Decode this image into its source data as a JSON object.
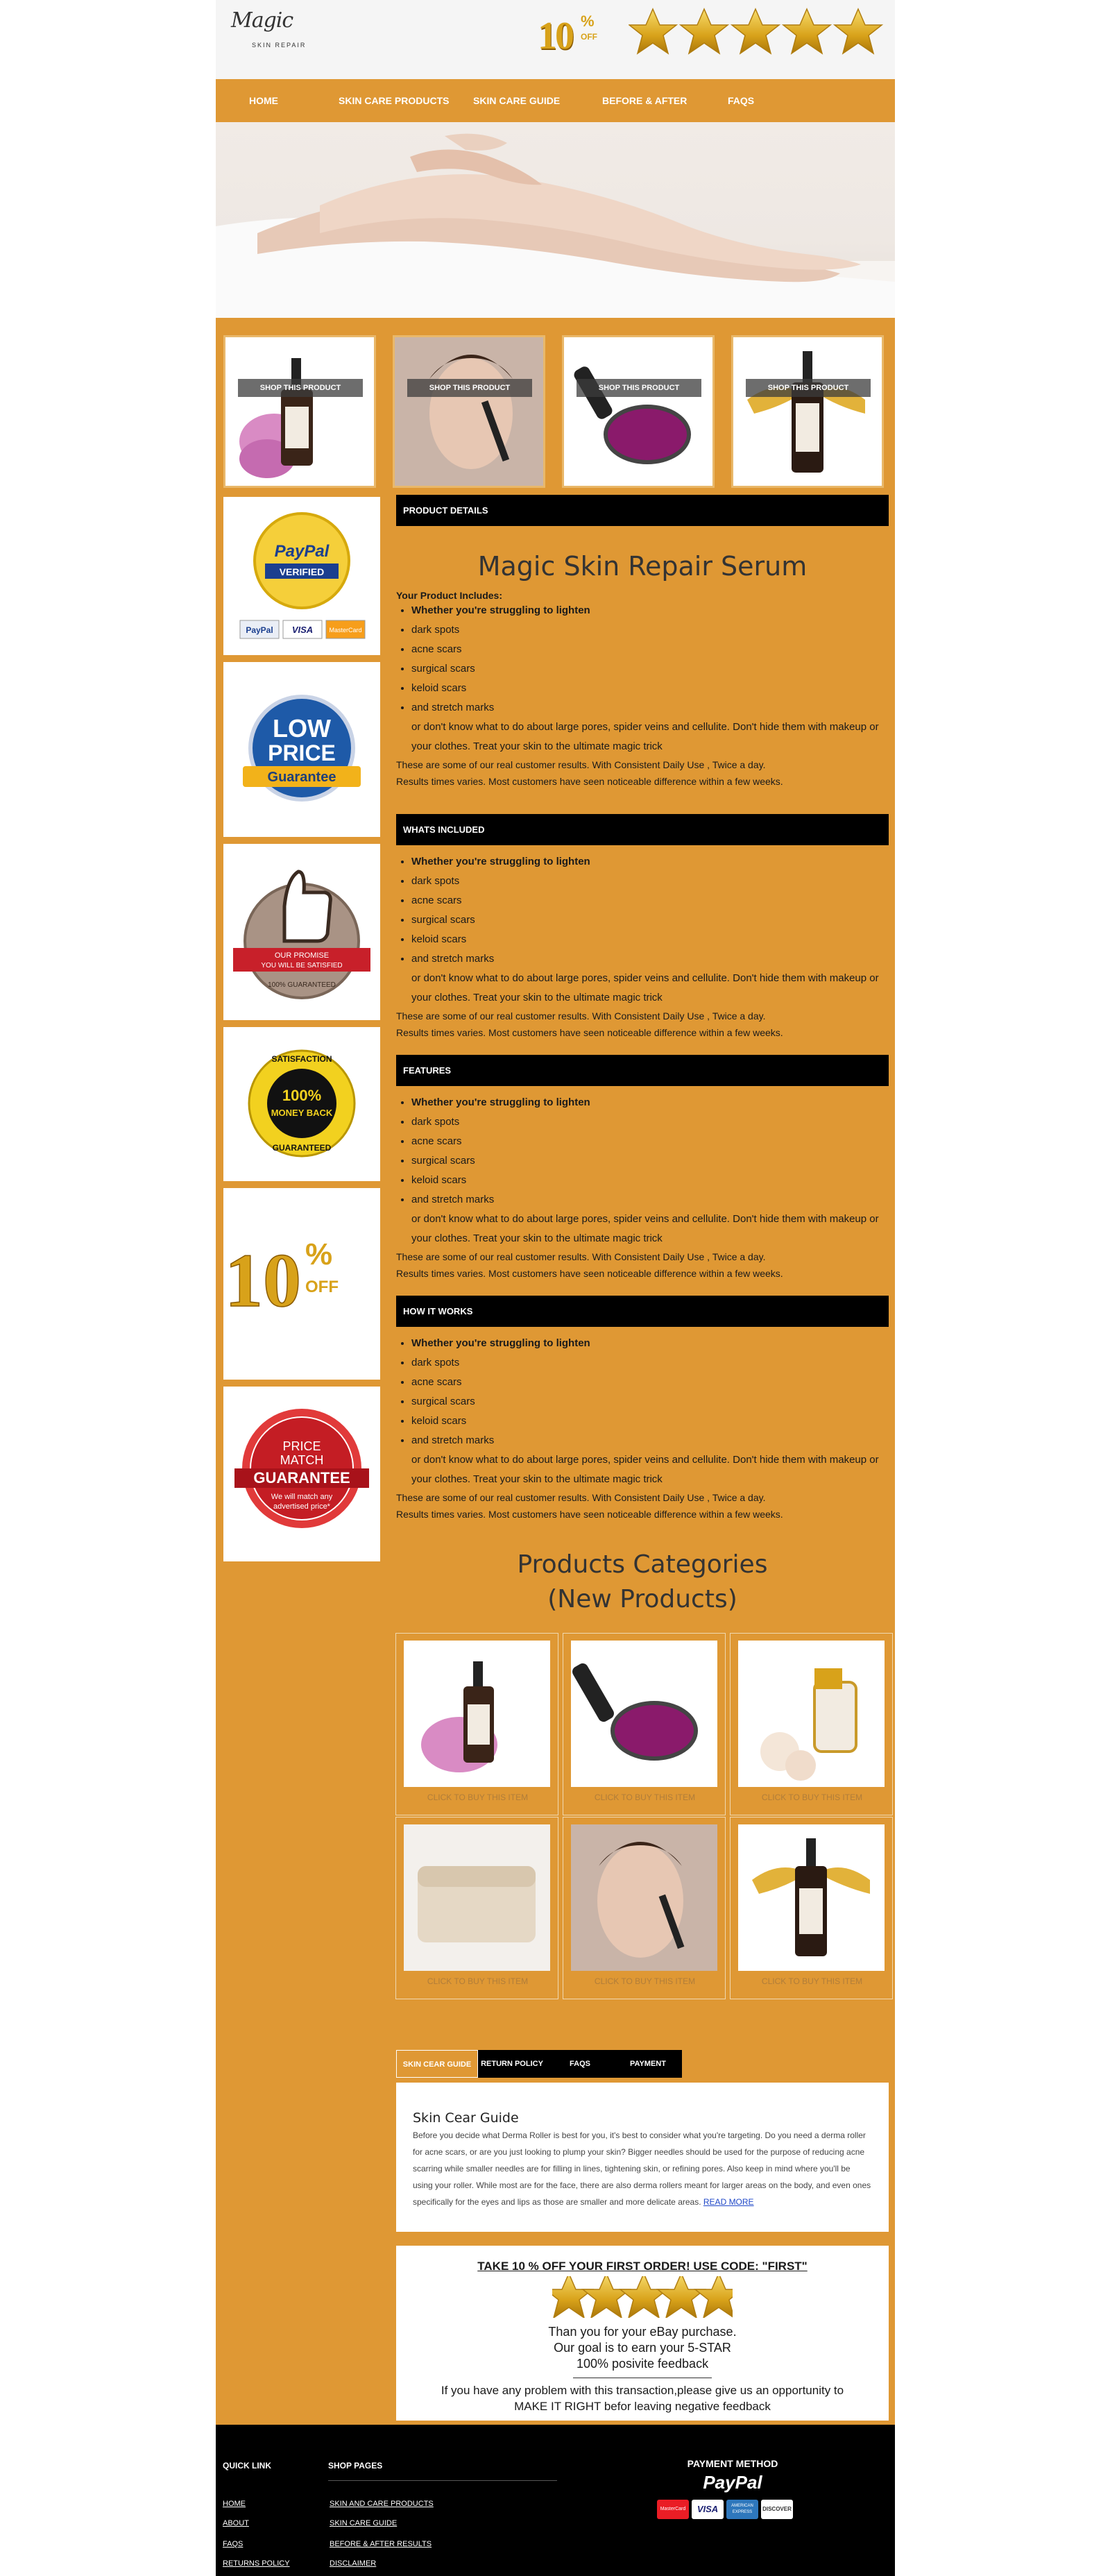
{
  "header": {
    "logo_script": "Magic",
    "logo_sub": "SKIN REPAIR",
    "badge_num": "10",
    "badge_pct": "%",
    "badge_word": "OFF",
    "stars": 5
  },
  "nav": [
    {
      "label": "HOME"
    },
    {
      "label": "SKIN CARE PRODUCTS"
    },
    {
      "label": "SKIN CARE GUIDE"
    },
    {
      "label": "BEFORE & AFTER"
    },
    {
      "label": "FAQS"
    }
  ],
  "product_tiles": [
    {
      "label": "SHOP THIS PRODUCT"
    },
    {
      "label": "SHOP THIS PRODUCT"
    },
    {
      "label": "SHOP THIS PRODUCT"
    },
    {
      "label": "SHOP THIS PRODUCT"
    }
  ],
  "sidebar": {
    "paypal": "PayPal",
    "paypal_verified": "VERIFIED",
    "card_paypal": "PayPal",
    "card_visa": "VISA",
    "card_mc": "MasterCard",
    "low_price_1": "LOW",
    "low_price_2": "PRICE",
    "low_price_3": "Guarantee",
    "promise_1": "OUR PROMISE",
    "promise_2": "YOU WILL BE SATISFIED",
    "promise_3": "100% GUARANTEED",
    "sat_1": "SATISFACTION",
    "sat_2": "100%",
    "sat_3": "MONEY BACK",
    "sat_4": "GUARANTEED",
    "ten": "10",
    "ten_pct": "%",
    "ten_off": "OFF",
    "pm_1": "PRICE",
    "pm_2": "MATCH",
    "pm_3": "GUARANTEE",
    "pm_4": "We will match any",
    "pm_5": "advertised price*"
  },
  "details": {
    "bar": "PRODUCT DETAILS",
    "title": "Magic Skin Repair Serum",
    "includes": "Your Product Includes:"
  },
  "sections": [
    {
      "bar": "WHATS INCLUDED"
    },
    {
      "bar": "FEATURES"
    },
    {
      "bar": "HOW IT WORKS"
    }
  ],
  "bullets": {
    "b1": "Whether you're struggling to lighten",
    "b2": "dark spots",
    "b3": "acne scars",
    "b4": "surgical scars",
    "b5": "keloid scars",
    "b6": "and stretch marks",
    "b6_cont": "or don't know what to do about large pores, spider veins and cellulite. Don't hide them with makeup or your clothes. Treat your skin to the ultimate magic trick",
    "p1": "These are some of our real customer results. With Consistent Daily Use , Twice a day.",
    "p2": "Results times varies. Most customers have seen noticeable difference within a few weeks."
  },
  "categories": {
    "title_1": "Products Categories",
    "title_2": "(New Products)",
    "caption": "CLICK TO BUY THIS ITEM"
  },
  "tabs": [
    {
      "label": "SKIN CEAR GUIDE"
    },
    {
      "label": "RETURN POLICY"
    },
    {
      "label": "FAQS"
    },
    {
      "label": "PAYMENT"
    }
  ],
  "guide": {
    "title": "Skin Cear Guide",
    "body": "Before you decide what Derma Roller is best for you, it's best to consider what you're targeting. Do you need a derma roller for acne scars, or are you just looking to plump your skin? Bigger needles should be used for the purpose of reducing acne scarring while smaller needles are for filling in lines, tightening skin, or refining pores. Also keep in mind where you'll be using your roller. While most are for the face, there are also derma rollers meant for larger areas on the body, and even ones specifically for the eyes and lips as those are smaller and more delicate areas.",
    "read_more": "READ MORE"
  },
  "promo": {
    "headline": "TAKE 10 % OFF YOUR FIRST ORDER! USE CODE: \"FIRST\"",
    "thanks_1": "Than you for your eBay purchase.",
    "thanks_2": "Our goal is to earn your 5-STAR",
    "thanks_3": "100% posivite feedback",
    "problem_1": "If you have any problem with this transaction,please give us an opportunity to",
    "problem_2": "MAKE IT RIGHT befor leaving negative feedback"
  },
  "footer": {
    "quick_link": "QUICK LINK",
    "shop_pages": "SHOP PAGES",
    "payment_method": "PAYMENT METHOD",
    "paypal": "PayPal",
    "quick": [
      {
        "label": "HOME"
      },
      {
        "label": "ABOUT"
      },
      {
        "label": "FAQS"
      },
      {
        "label": "RETURNS POLICY"
      }
    ],
    "shop": [
      {
        "label": "SKIN AND CARE PRODUCTS"
      },
      {
        "label": "SKIN CARE GUIDE"
      },
      {
        "label": "BEFORE & AFTER RESULTS"
      },
      {
        "label": "DISCLAIMER"
      }
    ],
    "cards": [
      {
        "label": "MasterCard"
      },
      {
        "label": "VISA"
      },
      {
        "label": "AMERICAN EXPRESS"
      },
      {
        "label": "DISCOVER"
      }
    ]
  },
  "colors": {
    "accent": "#df9834",
    "bar": "#000000",
    "title": "#333333",
    "gold": "#d8a21a"
  }
}
